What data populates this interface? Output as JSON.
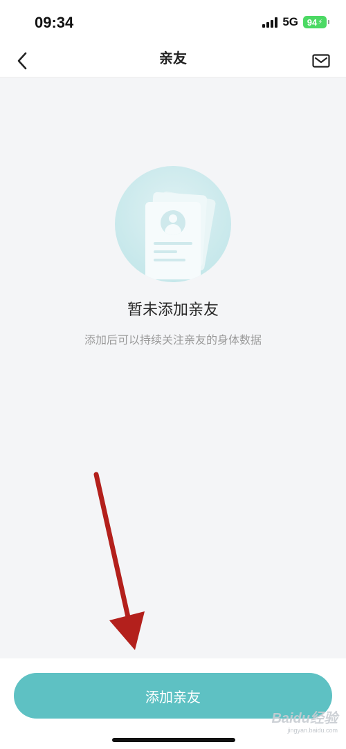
{
  "status_bar": {
    "time": "09:34",
    "network": "5G",
    "battery": "94",
    "icons": [
      "signal-icon",
      "battery-icon"
    ]
  },
  "nav": {
    "title": "亲友",
    "back_icon": "chevron-left-icon",
    "mail_icon": "mail-icon"
  },
  "empty_state": {
    "illustration_icon": "contact-card-icon",
    "title": "暂未添加亲友",
    "subtitle": "添加后可以持续关注亲友的身体数据"
  },
  "primary_action": {
    "label": "添加亲友"
  },
  "annotation": {
    "arrow_color": "#b3201c"
  },
  "watermark": {
    "brand": "Baidu经验",
    "sub": "jingyan.baidu.com"
  },
  "colors": {
    "accent": "#5ec1c3",
    "background": "#f4f5f7"
  }
}
